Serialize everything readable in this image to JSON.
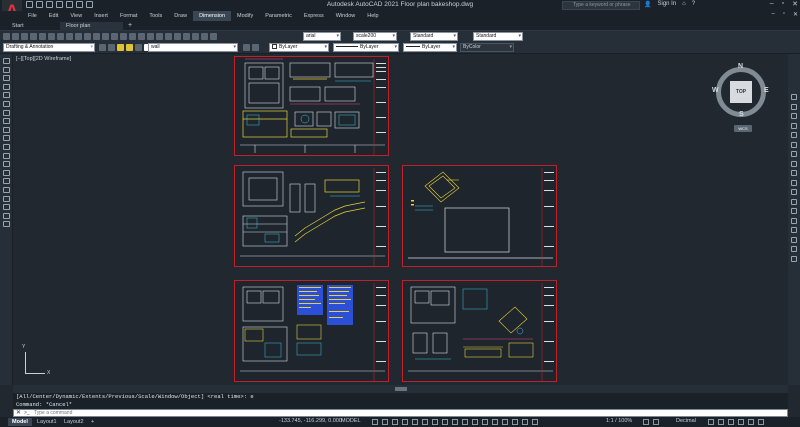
{
  "app": {
    "title": "Autodesk AutoCAD 2021   Floor plan bakeshop.dwg",
    "logo": "A",
    "search_placeholder": "Type a keyword or phrase",
    "user": "Sign In"
  },
  "menu": {
    "items": [
      "File",
      "Edit",
      "View",
      "Insert",
      "Format",
      "Tools",
      "Draw",
      "Dimension",
      "Modify",
      "Parametric",
      "Express",
      "Window",
      "Help"
    ],
    "active": "Dimension"
  },
  "file_tabs": {
    "start": "Start",
    "document": "Floor plan bakeshop*",
    "plus": "+"
  },
  "toolbar": {
    "workspace": "Drafting & Annotation",
    "layer": "wall",
    "text_style": "arial",
    "dim_style": "scale200",
    "table_style": "Standard",
    "mleader_style": "Standard",
    "color": "ByLayer",
    "linetype": "ByLayer",
    "lineweight": "ByLayer",
    "plotstyle": "ByColor"
  },
  "viewport": {
    "label": "[−][Top][2D Wireframe]"
  },
  "viewcube": {
    "face": "TOP",
    "north": "N",
    "south": "S",
    "east": "E",
    "west": "W",
    "wcs": "WCS"
  },
  "ucs": {
    "x": "X",
    "y": "Y"
  },
  "command": {
    "history": [
      "[All/Center/Dynamic/Extents/Previous/Scale/Window/Object] <real time>: e",
      "Command: *Cancel*"
    ],
    "placeholder": "Type a command",
    "prompt_icon": ">_"
  },
  "status": {
    "tabs": [
      "Model",
      "Layout1",
      "Layout2"
    ],
    "active_tab": "Model",
    "plus": "+",
    "coords": "-133.745, -116.299, 0.000",
    "model": "MODEL",
    "scale": "1:1 / 100%",
    "units": "Decimal"
  },
  "colors": {
    "sheet_border": "#c0202a",
    "canvas_bg": "#212830",
    "accent": "#e8323c"
  }
}
